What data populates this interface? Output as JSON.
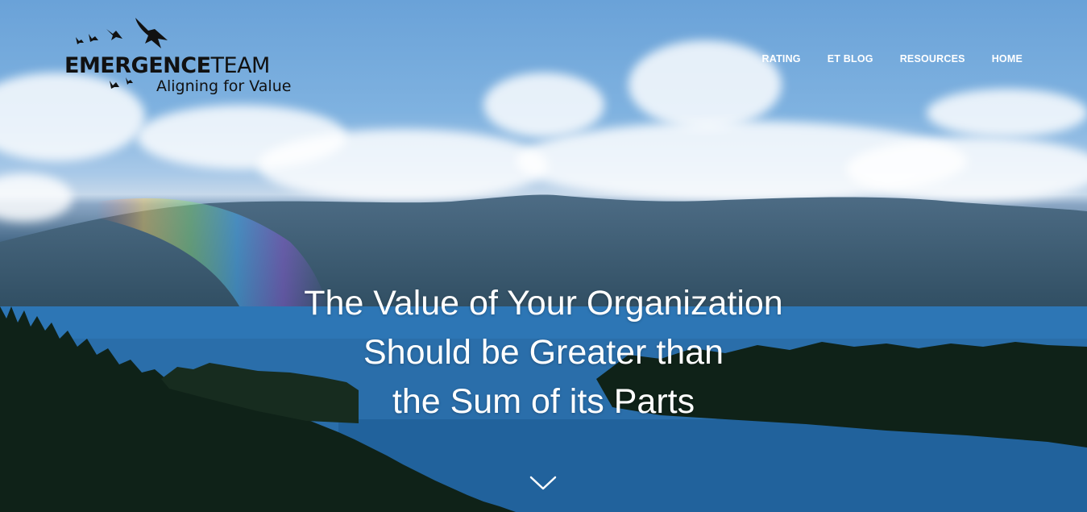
{
  "brand": {
    "name_bold": "EMERGENCE",
    "name_light": "TEAM",
    "tagline": "Aligning for Value",
    "logo_color": "#111111"
  },
  "nav": {
    "items": [
      {
        "label": "RATING"
      },
      {
        "label": "ET BLOG"
      },
      {
        "label": "RESOURCES"
      },
      {
        "label": "HOME"
      }
    ],
    "color": "#ffffff"
  },
  "hero": {
    "lines": [
      "The Value of Your Organization",
      "Should be Greater than",
      "the Sum of its Parts"
    ],
    "scroll_icon": "chevron-down-icon"
  }
}
